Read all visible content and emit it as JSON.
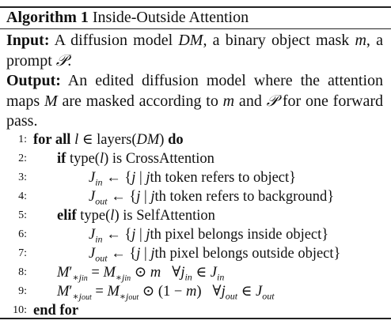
{
  "algorithm": {
    "label": "Algorithm 1",
    "title": "Inside-Outside Attention"
  },
  "input": {
    "label": "Input:",
    "line1": "A diffusion model DM, a binary object mask m, a",
    "line2": "prompt 𝒫."
  },
  "output": {
    "label": "Output:",
    "line1": "An edited diffusion model where the attention",
    "line2": "maps M are masked according to m and 𝒫 for one forward",
    "line3": "pass."
  },
  "steps": [
    {
      "num": "1:",
      "kw": "for all",
      "text": "l ∈ layers(DM)",
      "kw2": "do"
    },
    {
      "num": "2:",
      "kw": "if",
      "text": "type(l) is CrossAttention"
    },
    {
      "num": "3:",
      "text": "J_in ← {j | jth token refers to object}"
    },
    {
      "num": "4:",
      "text": "J_out ← {j | jth token refers to background}"
    },
    {
      "num": "5:",
      "kw": "elif",
      "text": "type(l) is SelfAttention"
    },
    {
      "num": "6:",
      "text": "J_in ← {j | jth pixel belongs inside object}"
    },
    {
      "num": "7:",
      "text": "J_out ← {j | jth pixel belongs outside object}"
    },
    {
      "num": "8:",
      "text": "M′*j_in = M*j_in ⊙ m   ∀j_in ∈ J_in"
    },
    {
      "num": "9:",
      "text": "M′*j_out = M*j_out ⊙ (1 − m)   ∀j_out ∈ J_out"
    },
    {
      "num": "10:",
      "kw": "end for"
    }
  ]
}
